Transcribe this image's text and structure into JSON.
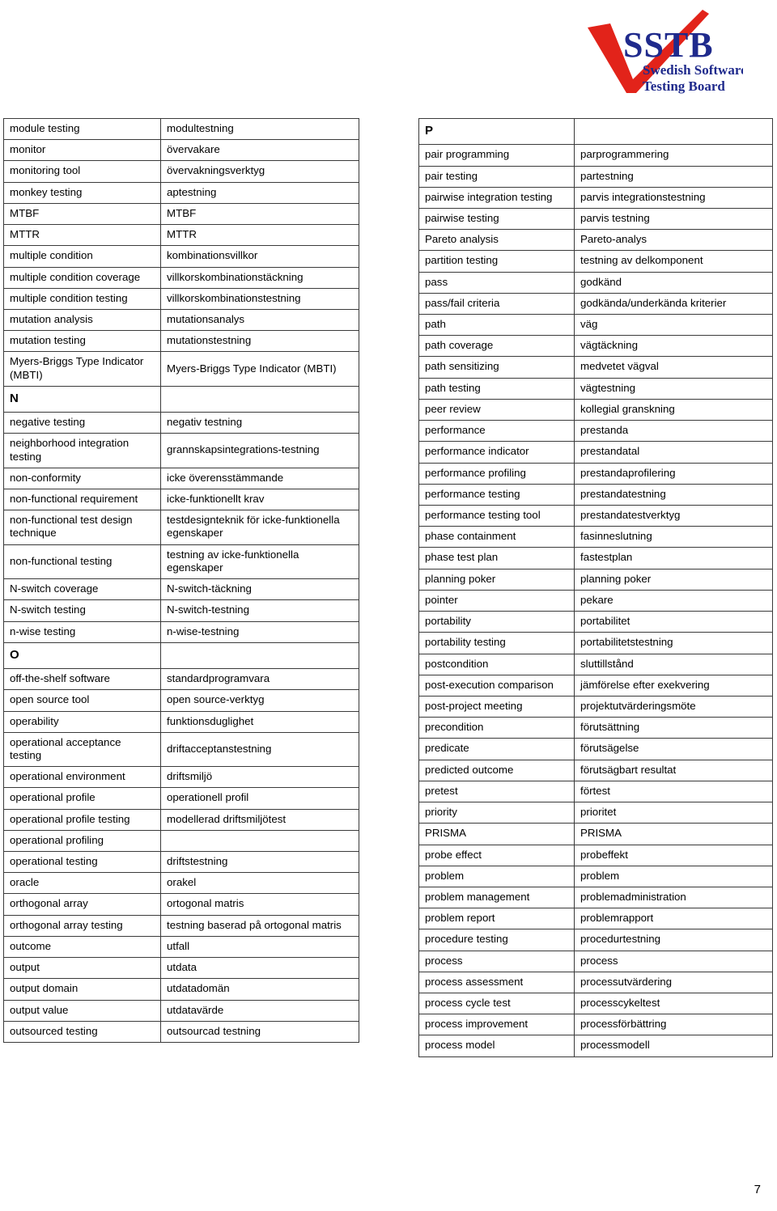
{
  "logo": {
    "acronym": "SSTB",
    "line1": "Swedish Software",
    "line2": "Testing Board",
    "checkmark_color": "#E2231A",
    "text_color": "#1F2A8C"
  },
  "footer": {
    "page_number": "7"
  },
  "left_table": {
    "rows": [
      {
        "type": "entry",
        "term": "module testing",
        "translation": "modultestning"
      },
      {
        "type": "entry",
        "term": "monitor",
        "translation": "övervakare"
      },
      {
        "type": "entry",
        "term": "monitoring tool",
        "translation": "övervakningsverktyg"
      },
      {
        "type": "entry",
        "term": "monkey testing",
        "translation": "aptestning"
      },
      {
        "type": "entry",
        "term": "MTBF",
        "translation": "MTBF"
      },
      {
        "type": "entry",
        "term": "MTTR",
        "translation": "MTTR"
      },
      {
        "type": "entry",
        "term": "multiple condition",
        "translation": "kombinationsvillkor"
      },
      {
        "type": "entry",
        "term": "multiple condition coverage",
        "translation": "villkorskombinationstäckning"
      },
      {
        "type": "entry",
        "term": "multiple condition testing",
        "translation": "villkorskombinationstestning"
      },
      {
        "type": "entry",
        "term": "mutation analysis",
        "translation": "mutationsanalys"
      },
      {
        "type": "entry",
        "term": "mutation testing",
        "translation": "mutationstestning"
      },
      {
        "type": "entry",
        "term": "Myers-Briggs Type Indicator (MBTI)",
        "translation": "Myers-Briggs Type Indicator (MBTI)"
      },
      {
        "type": "section",
        "term": "N",
        "translation": ""
      },
      {
        "type": "entry",
        "term": "negative testing",
        "translation": "negativ testning"
      },
      {
        "type": "entry",
        "term": "neighborhood integration testing",
        "translation": "grannskapsintegrations-testning"
      },
      {
        "type": "entry",
        "term": "non-conformity",
        "translation": "icke överensstämmande"
      },
      {
        "type": "entry",
        "term": "non-functional requirement",
        "translation": "icke-funktionellt krav"
      },
      {
        "type": "entry",
        "term": "non-functional test design technique",
        "translation": "testdesignteknik för icke-funktionella egenskaper"
      },
      {
        "type": "entry",
        "term": "non-functional testing",
        "translation": "testning av icke-funktionella egenskaper"
      },
      {
        "type": "entry",
        "term": "N-switch coverage",
        "translation": "N-switch-täckning"
      },
      {
        "type": "entry",
        "term": "N-switch testing",
        "translation": "N-switch-testning"
      },
      {
        "type": "entry",
        "term": "n-wise testing",
        "translation": "n-wise-testning"
      },
      {
        "type": "section",
        "term": "O",
        "translation": ""
      },
      {
        "type": "entry",
        "term": "off-the-shelf software",
        "translation": "standardprogramvara"
      },
      {
        "type": "entry",
        "term": "open source tool",
        "translation": "open source-verktyg"
      },
      {
        "type": "entry",
        "term": "operability",
        "translation": "funktionsduglighet"
      },
      {
        "type": "entry",
        "term": "operational acceptance testing",
        "translation": "driftacceptanstestning"
      },
      {
        "type": "entry",
        "term": "operational environment",
        "translation": "driftsmiljö"
      },
      {
        "type": "entry",
        "term": "operational profile",
        "translation": "operationell profil"
      },
      {
        "type": "entry",
        "term": "operational profile testing",
        "translation": "modellerad driftsmiljötest"
      },
      {
        "type": "entry",
        "term": "operational profiling",
        "translation": ""
      },
      {
        "type": "entry",
        "term": "operational testing",
        "translation": "driftstestning"
      },
      {
        "type": "entry",
        "term": "oracle",
        "translation": "orakel"
      },
      {
        "type": "entry",
        "term": "orthogonal array",
        "translation": "ortogonal matris"
      },
      {
        "type": "entry",
        "term": "orthogonal array testing",
        "translation": "testning baserad på ortogonal matris"
      },
      {
        "type": "entry",
        "term": "outcome",
        "translation": "utfall"
      },
      {
        "type": "entry",
        "term": "output",
        "translation": "utdata"
      },
      {
        "type": "entry",
        "term": "output domain",
        "translation": "utdatadomän"
      },
      {
        "type": "entry",
        "term": "output value",
        "translation": "utdatavärde"
      },
      {
        "type": "entry",
        "term": "outsourced testing",
        "translation": "outsourcad testning"
      }
    ]
  },
  "right_table": {
    "rows": [
      {
        "type": "section",
        "term": "P",
        "translation": ""
      },
      {
        "type": "entry",
        "term": "pair programming",
        "translation": "parprogrammering"
      },
      {
        "type": "entry",
        "term": "pair testing",
        "translation": "partestning"
      },
      {
        "type": "entry",
        "term": "pairwise integration testing",
        "translation": "parvis integrationstestning"
      },
      {
        "type": "entry",
        "term": "pairwise testing",
        "translation": "parvis testning"
      },
      {
        "type": "entry",
        "term": "Pareto analysis",
        "translation": "Pareto-analys"
      },
      {
        "type": "entry",
        "term": "partition testing",
        "translation": "testning av delkomponent"
      },
      {
        "type": "entry",
        "term": "pass",
        "translation": "godkänd"
      },
      {
        "type": "entry",
        "term": "pass/fail criteria",
        "translation": "godkända/underkända kriterier"
      },
      {
        "type": "entry",
        "term": "path",
        "translation": "väg"
      },
      {
        "type": "entry",
        "term": "path coverage",
        "translation": "vägtäckning"
      },
      {
        "type": "entry",
        "term": "path sensitizing",
        "translation": "medvetet vägval"
      },
      {
        "type": "entry",
        "term": "path testing",
        "translation": "vägtestning"
      },
      {
        "type": "entry",
        "term": "peer review",
        "translation": "kollegial granskning"
      },
      {
        "type": "entry",
        "term": "performance",
        "translation": "prestanda"
      },
      {
        "type": "entry",
        "term": "performance indicator",
        "translation": "prestandatal"
      },
      {
        "type": "entry",
        "term": "performance profiling",
        "translation": "prestandaprofilering"
      },
      {
        "type": "entry",
        "term": "performance testing",
        "translation": "prestandatestning"
      },
      {
        "type": "entry",
        "term": "performance testing tool",
        "translation": "prestandatestverktyg"
      },
      {
        "type": "entry",
        "term": "phase containment",
        "translation": "fasinneslutning"
      },
      {
        "type": "entry",
        "term": "phase test plan",
        "translation": "fastestplan"
      },
      {
        "type": "entry",
        "term": "planning poker",
        "translation": "planning poker"
      },
      {
        "type": "entry",
        "term": "pointer",
        "translation": "pekare"
      },
      {
        "type": "entry",
        "term": "portability",
        "translation": "portabilitet"
      },
      {
        "type": "entry",
        "term": "portability testing",
        "translation": "portabilitetstestning"
      },
      {
        "type": "entry",
        "term": "postcondition",
        "translation": "sluttillstånd"
      },
      {
        "type": "entry",
        "term": "post-execution comparison",
        "translation": "jämförelse efter exekvering"
      },
      {
        "type": "entry",
        "term": "post-project meeting",
        "translation": "projektutvärderingsmöte"
      },
      {
        "type": "entry",
        "term": "precondition",
        "translation": "förutsättning"
      },
      {
        "type": "entry",
        "term": "predicate",
        "translation": "förutsägelse"
      },
      {
        "type": "entry",
        "term": "predicted outcome",
        "translation": "förutsägbart resultat"
      },
      {
        "type": "entry",
        "term": "pretest",
        "translation": "förtest"
      },
      {
        "type": "entry",
        "term": "priority",
        "translation": "prioritet"
      },
      {
        "type": "entry",
        "term": "PRISMA",
        "translation": "PRISMA"
      },
      {
        "type": "entry",
        "term": "probe effect",
        "translation": "probeffekt"
      },
      {
        "type": "entry",
        "term": "problem",
        "translation": "problem"
      },
      {
        "type": "entry",
        "term": "problem management",
        "translation": "problemadministration"
      },
      {
        "type": "entry",
        "term": "problem report",
        "translation": "problemrapport"
      },
      {
        "type": "entry",
        "term": "procedure testing",
        "translation": "procedurtestning"
      },
      {
        "type": "entry",
        "term": "process",
        "translation": "process"
      },
      {
        "type": "entry",
        "term": "process assessment",
        "translation": "processutvärdering"
      },
      {
        "type": "entry",
        "term": "process cycle test",
        "translation": "processcykeltest"
      },
      {
        "type": "entry",
        "term": "process improvement",
        "translation": "processförbättring"
      },
      {
        "type": "entry",
        "term": "process model",
        "translation": "processmodell"
      }
    ]
  }
}
